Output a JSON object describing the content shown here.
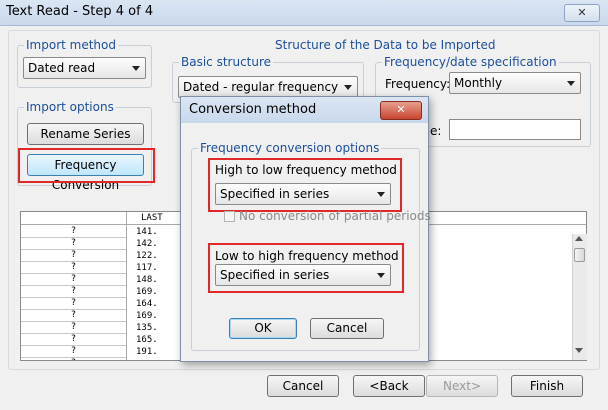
{
  "window": {
    "title": "Text Read - Step 4 of 4",
    "close": "✕"
  },
  "import_method": {
    "legend": "Import method",
    "value": "Dated read"
  },
  "import_options": {
    "legend": "Import options",
    "rename_label": "Rename Series",
    "freq_conv_label": "Frequency Conversion"
  },
  "structure": {
    "heading": "Structure of the Data to be Imported",
    "basic": {
      "legend": "Basic structure",
      "value": "Dated - regular frequency"
    },
    "freq_spec": {
      "legend": "Frequency/date specification",
      "freq_label": "Frequency:",
      "freq_value": "Monthly",
      "partial_label": "e:"
    }
  },
  "table": {
    "header": "LAST",
    "rows": [
      {
        "q": "?",
        "v": "141."
      },
      {
        "q": "?",
        "v": "142."
      },
      {
        "q": "?",
        "v": "122."
      },
      {
        "q": "?",
        "v": "117."
      },
      {
        "q": "?",
        "v": "148."
      },
      {
        "q": "?",
        "v": "169."
      },
      {
        "q": "?",
        "v": "164."
      },
      {
        "q": "?",
        "v": "169."
      },
      {
        "q": "?",
        "v": "135."
      },
      {
        "q": "?",
        "v": "165."
      },
      {
        "q": "?",
        "v": "191."
      },
      {
        "q": "?",
        "v": ""
      }
    ]
  },
  "footer": {
    "cancel": "Cancel",
    "back": "<Back",
    "next": "Next>",
    "finish": "Finish"
  },
  "dialog": {
    "title": "Conversion method",
    "close": "✕",
    "group_legend": "Frequency conversion options",
    "high_to_low_label": "High to low frequency method",
    "high_to_low_value": "Specified in series",
    "no_partial_label": "No conversion of partial periods",
    "low_to_high_label": "Low to high frequency method",
    "low_to_high_value": "Specified in series",
    "ok": "OK",
    "cancel": "Cancel"
  },
  "colors": {
    "accent": "#1b4f9c",
    "highlight": "#e02828"
  }
}
